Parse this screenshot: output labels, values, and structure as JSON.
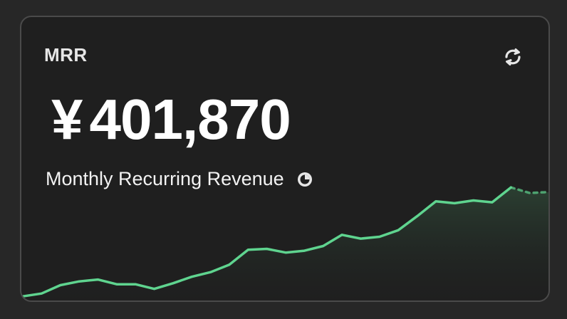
{
  "card": {
    "title": "MRR",
    "currency_symbol": "¥",
    "value": "401,870",
    "subtitle": "Monthly Recurring Revenue",
    "refresh_icon": "refresh-icon",
    "info_icon": "clock-icon"
  },
  "colors": {
    "background": "#272727",
    "card": "#1f1f1f",
    "border": "#4a4a4a",
    "line": "#5fd48f",
    "fill": "#2f4a38"
  },
  "chart_data": {
    "type": "area",
    "title": "",
    "xlabel": "",
    "ylabel": "",
    "grid": false,
    "series": [
      {
        "values": [
          286000,
          289000,
          298000,
          302000,
          304000,
          299000,
          299000,
          294000,
          300000,
          307000,
          312000,
          320000,
          336000,
          337000,
          333000,
          335000,
          340000,
          352000,
          348000,
          350000,
          357000,
          372000,
          388000,
          386000,
          389000,
          387000,
          403000,
          397000,
          398000
        ],
        "projected_from_index": 27
      }
    ],
    "ylim": [
      280000,
      410000
    ]
  }
}
